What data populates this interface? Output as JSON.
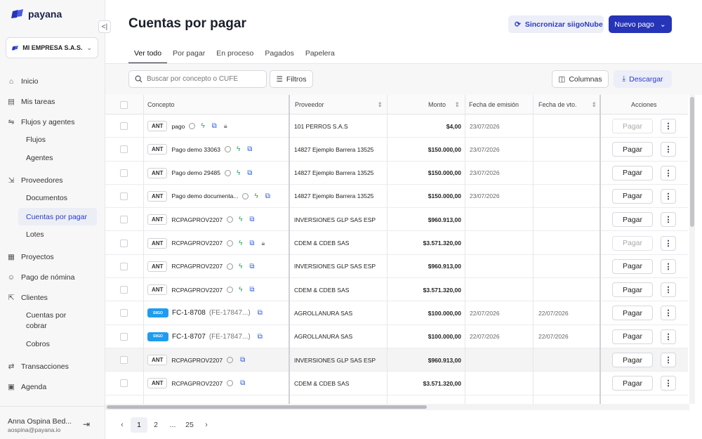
{
  "brand": {
    "name": "payana",
    "color": "#2634b8"
  },
  "sidebar": {
    "company": "MI EMPRESA S.A.S.",
    "items": [
      {
        "label": "Inicio",
        "icon": "home-icon"
      },
      {
        "label": "Mis tareas",
        "icon": "clipboard-icon"
      },
      {
        "label": "Flujos y agentes",
        "icon": "flow-icon"
      },
      {
        "label": "Flujos"
      },
      {
        "label": "Agentes"
      },
      {
        "label": "Proveedores",
        "icon": "provider-icon"
      },
      {
        "label": "Documentos"
      },
      {
        "label": "Cuentas por pagar"
      },
      {
        "label": "Lotes"
      },
      {
        "label": "Proyectos",
        "icon": "project-icon"
      },
      {
        "label": "Pago de nómina",
        "icon": "payroll-icon"
      },
      {
        "label": "Clientes",
        "icon": "clients-icon"
      },
      {
        "label": "Cuentas por cobrar"
      },
      {
        "label": "Cobros"
      },
      {
        "label": "Transacciones",
        "icon": "transfer-icon"
      },
      {
        "label": "Agenda",
        "icon": "agenda-icon"
      }
    ],
    "user": {
      "name": "Anna Ospina Bed...",
      "email": "aospina@payana.io"
    }
  },
  "header": {
    "title": "Cuentas por pagar",
    "sync_label": "Sincronizar siigoNube",
    "new_label": "Nuevo pago"
  },
  "tabs": [
    "Ver todo",
    "Por pagar",
    "En proceso",
    "Pagados",
    "Papelera"
  ],
  "toolbar": {
    "search_placeholder": "Buscar por concepto o CUFE",
    "filters_label": "Filtros",
    "columns_label": "Columnas",
    "download_label": "Descargar"
  },
  "table": {
    "columns": [
      "Concepto",
      "Proveedor",
      "Monto",
      "Fecha de emisión",
      "Fecha de vto.",
      "Acciones"
    ],
    "pay_label": "Pagar",
    "badge_ant": "ANT",
    "badge_siigo": "SIIGO",
    "rows": [
      {
        "type": "ANT",
        "concept": "pago",
        "sub": "",
        "provider": "101 PERROS S.A.S",
        "amount": "$4,00",
        "issue": "23/07/2026",
        "due": "",
        "lock": true,
        "disabled": true,
        "bolt": true
      },
      {
        "type": "ANT",
        "concept": "Pago demo 33063",
        "sub": "",
        "provider": "14827 Ejemplo Barrera 13525",
        "amount": "$150.000,00",
        "issue": "23/07/2026",
        "due": "",
        "lock": false,
        "disabled": false,
        "bolt": true
      },
      {
        "type": "ANT",
        "concept": "Pago demo 29485",
        "sub": "",
        "provider": "14827 Ejemplo Barrera 13525",
        "amount": "$150.000,00",
        "issue": "23/07/2026",
        "due": "",
        "lock": false,
        "disabled": false,
        "bolt": true
      },
      {
        "type": "ANT",
        "concept": "Pago demo documenta...",
        "sub": "",
        "provider": "14827 Ejemplo Barrera 13525",
        "amount": "$150.000,00",
        "issue": "23/07/2026",
        "due": "",
        "lock": false,
        "disabled": false,
        "bolt": true
      },
      {
        "type": "ANT",
        "concept": "RCPAGPROV2207",
        "sub": "",
        "provider": "INVERSIONES GLP SAS ESP",
        "amount": "$960.913,00",
        "issue": "",
        "due": "",
        "lock": false,
        "disabled": false,
        "bolt": true
      },
      {
        "type": "ANT",
        "concept": "RCPAGPROV2207",
        "sub": "",
        "provider": "CDEM & CDEB SAS",
        "amount": "$3.571.320,00",
        "issue": "",
        "due": "",
        "lock": true,
        "disabled": true,
        "bolt": true
      },
      {
        "type": "ANT",
        "concept": "RCPAGPROV2207",
        "sub": "",
        "provider": "INVERSIONES GLP SAS ESP",
        "amount": "$960.913,00",
        "issue": "",
        "due": "",
        "lock": false,
        "disabled": false,
        "bolt": true
      },
      {
        "type": "ANT",
        "concept": "RCPAGPROV2207",
        "sub": "",
        "provider": "CDEM & CDEB SAS",
        "amount": "$3.571.320,00",
        "issue": "",
        "due": "",
        "lock": false,
        "disabled": false,
        "bolt": true
      },
      {
        "type": "SIIGO",
        "concept": "FC-1-8708",
        "sub": "(FE-17847...)",
        "provider": "AGROLLANURA SAS",
        "amount": "$100.000,00",
        "issue": "22/07/2026",
        "due": "22/07/2026",
        "lock": false,
        "disabled": false,
        "bolt": false
      },
      {
        "type": "SIIGO",
        "concept": "FC-1-8707",
        "sub": "(FE-17847...)",
        "provider": "AGROLLANURA SAS",
        "amount": "$100.000,00",
        "issue": "22/07/2026",
        "due": "22/07/2026",
        "lock": false,
        "disabled": false,
        "bolt": false
      },
      {
        "type": "ANT",
        "concept": "RCPAGPROV2207",
        "sub": "",
        "provider": "INVERSIONES GLP SAS ESP",
        "amount": "$960.913,00",
        "issue": "",
        "due": "",
        "lock": false,
        "disabled": false,
        "bolt": false
      },
      {
        "type": "ANT",
        "concept": "RCPAGPROV2207",
        "sub": "",
        "provider": "CDEM & CDEB SAS",
        "amount": "$3.571.320,00",
        "issue": "",
        "due": "",
        "lock": false,
        "disabled": false,
        "bolt": false
      }
    ]
  },
  "pagination": {
    "pages": [
      "1",
      "2",
      "...",
      "25"
    ],
    "current": "1"
  }
}
